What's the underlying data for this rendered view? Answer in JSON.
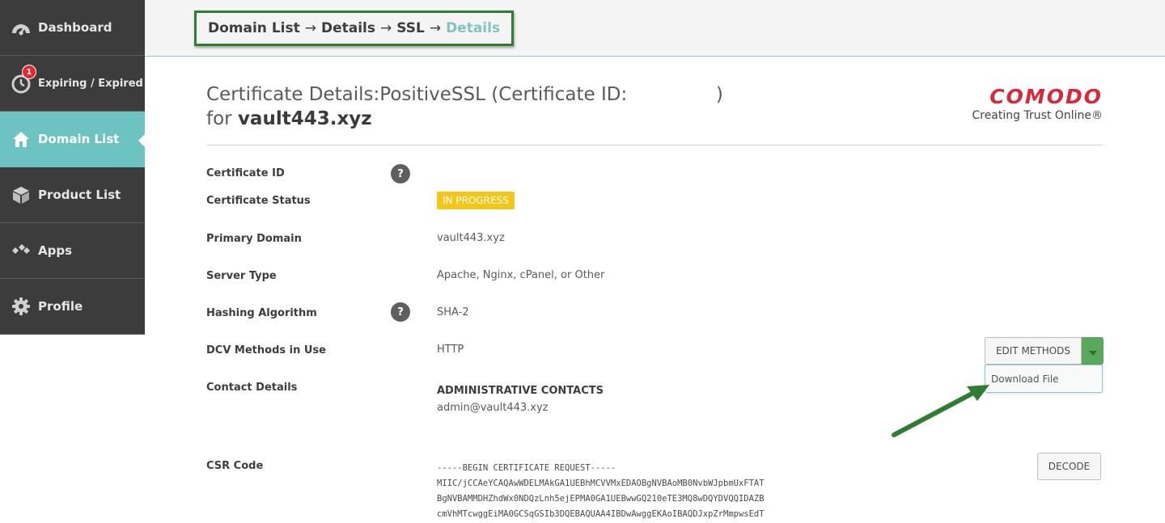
{
  "sidebar": {
    "items": [
      {
        "label": "Dashboard",
        "icon": "dashboard-gauge-icon",
        "active": false
      },
      {
        "label": "Expiring / Expired",
        "icon": "stopwatch-icon",
        "badge": "1",
        "active": false
      },
      {
        "label": "Domain List",
        "icon": "home-icon",
        "active": true
      },
      {
        "label": "Product List",
        "icon": "box-icon",
        "active": false
      },
      {
        "label": "Apps",
        "icon": "apps-diamonds-icon",
        "active": false
      },
      {
        "label": "Profile",
        "icon": "gear-icon",
        "active": false
      }
    ]
  },
  "breadcrumb": {
    "items": [
      "Domain List",
      "Details",
      "SSL"
    ],
    "current": "Details",
    "separator": "→"
  },
  "header": {
    "title_prefix": "Certificate Details:PositiveSSL (Certificate ID:",
    "title_suffix": ")",
    "for_label": "for",
    "domain": "vault443.xyz"
  },
  "logo": {
    "brand": "COMODO",
    "tagline": "Creating Trust Online®"
  },
  "details": {
    "certificate_id": {
      "label": "Certificate ID",
      "value": ""
    },
    "certificate_status": {
      "label": "Certificate Status",
      "value": "IN PROGRESS"
    },
    "primary_domain": {
      "label": "Primary Domain",
      "value": "vault443.xyz"
    },
    "server_type": {
      "label": "Server Type",
      "value": "Apache, Nginx, cPanel, or Other"
    },
    "hashing_algorithm": {
      "label": "Hashing Algorithm",
      "value": "SHA-2"
    },
    "dcv_methods": {
      "label": "DCV Methods in Use",
      "value": "HTTP"
    },
    "contact_details": {
      "label": "Contact Details",
      "heading": "ADMINISTRATIVE CONTACTS",
      "email": "admin@vault443.xyz"
    },
    "csr_code": {
      "label": "CSR Code"
    }
  },
  "help_icon_text": "?",
  "buttons": {
    "edit_methods": "EDIT METHODS",
    "download_file": "Download File",
    "decode": "DECODE"
  },
  "csr_text": "-----BEGIN CERTIFICATE REQUEST-----\nMIIC/jCCAeYCAQAwWDELMAkGA1UEBhMCVVMxEDAOBgNVBAoMB0NvbWJpbmUxFTAT\nBgNVBAMMDHZhdWx0NDQzLnh5ejEPMA0GA1UEBwwGQ210eTE3MQ8wDQYDVQQIDAZB\ncmVhMTcwggEiMA0GCSqGSIb3DQEBAQUAA4IBDwAwggEKAoIBAQDJxpZrMmpwsEdT",
  "colors": {
    "sidebar_bg": "#3c3c3c",
    "active_item": "#6cc3c1",
    "status_badge": "#f5c518",
    "annotation_green": "#2e7d32",
    "brand_red": "#d42a3a"
  }
}
